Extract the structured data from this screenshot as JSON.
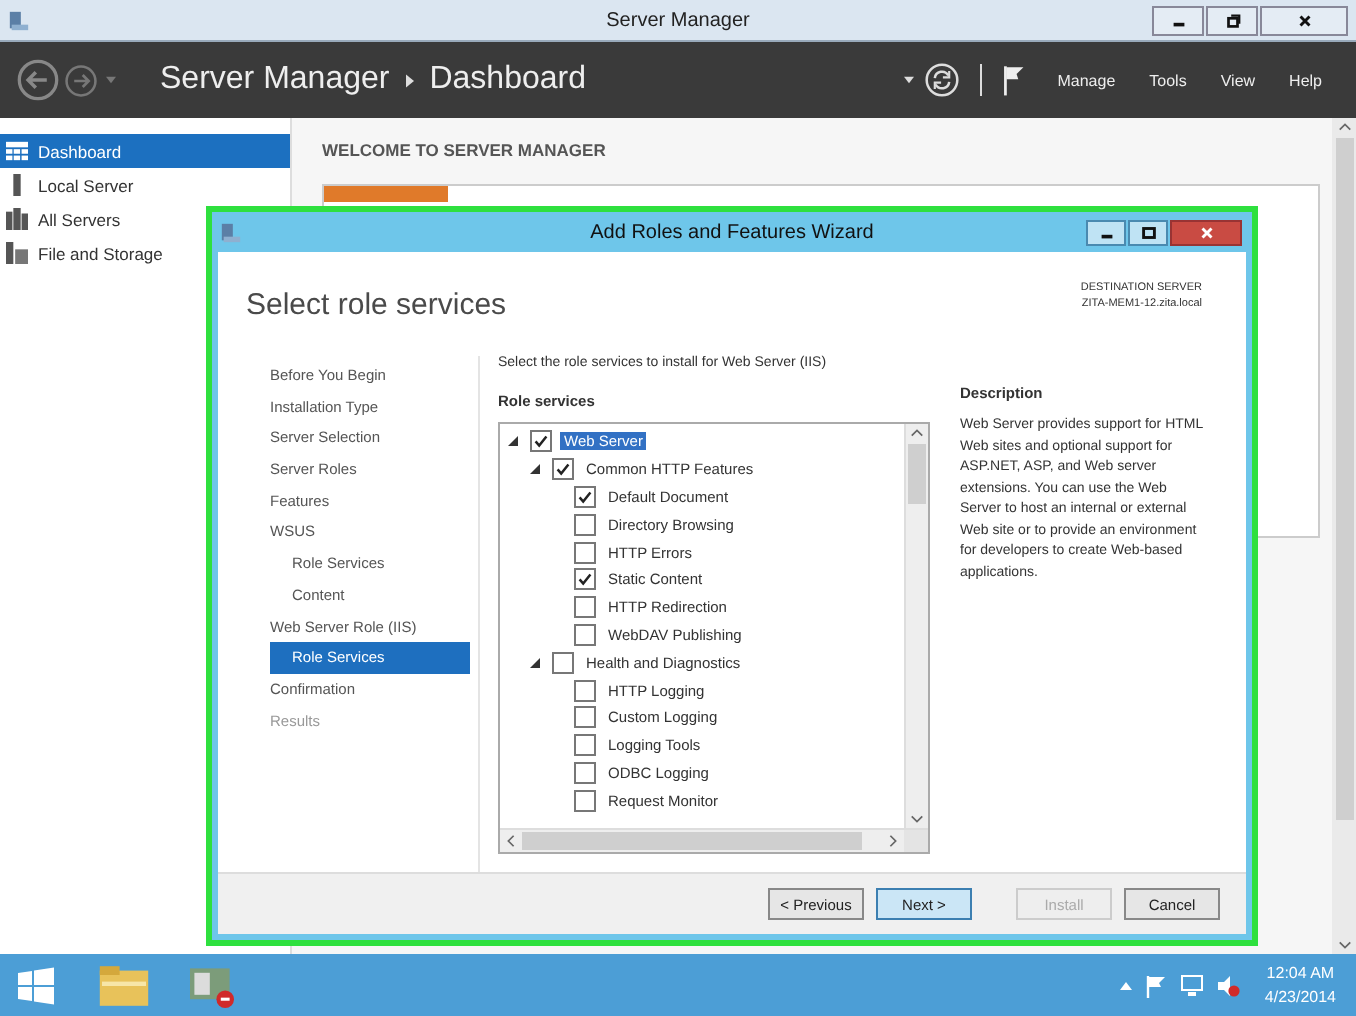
{
  "window": {
    "title": "Server Manager"
  },
  "header": {
    "breadcrumb": [
      "Server Manager",
      "Dashboard"
    ],
    "menus": [
      "Manage",
      "Tools",
      "View",
      "Help"
    ]
  },
  "sidebar": {
    "items": [
      {
        "label": "Dashboard",
        "selected": true
      },
      {
        "label": "Local Server",
        "selected": false
      },
      {
        "label": "All Servers",
        "selected": false
      },
      {
        "label": "File and Storage",
        "selected": false
      }
    ]
  },
  "main": {
    "heading": "WELCOME TO SERVER MANAGER"
  },
  "wizard": {
    "title": "Add Roles and Features Wizard",
    "heading": "Select role services",
    "destination_label": "DESTINATION SERVER",
    "destination_server": "ZITA-MEM1-12.zita.local",
    "nav": [
      {
        "label": "Before You Begin",
        "selected": false,
        "disabled": false
      },
      {
        "label": "Installation Type",
        "selected": false,
        "disabled": false
      },
      {
        "label": "Server Selection",
        "selected": false,
        "disabled": false
      },
      {
        "label": "Server Roles",
        "selected": false,
        "disabled": false
      },
      {
        "label": "Features",
        "selected": false,
        "disabled": false
      },
      {
        "label": "WSUS",
        "selected": false,
        "disabled": false,
        "children": [
          {
            "label": "Role Services",
            "selected": false,
            "disabled": false
          },
          {
            "label": "Content",
            "selected": false,
            "disabled": false
          }
        ]
      },
      {
        "label": "Web Server Role (IIS)",
        "selected": false,
        "disabled": false,
        "children": [
          {
            "label": "Role Services",
            "selected": true,
            "disabled": false
          }
        ]
      },
      {
        "label": "Confirmation",
        "selected": false,
        "disabled": false
      },
      {
        "label": "Results",
        "selected": false,
        "disabled": true
      }
    ],
    "instruction": "Select the role services to install for Web Server (IIS)",
    "list_label": "Role services",
    "tree": [
      {
        "label": "Web Server",
        "checked": true,
        "expanded": true,
        "selected": true,
        "children": [
          {
            "label": "Common HTTP Features",
            "checked": true,
            "expanded": true,
            "selected": false,
            "children": [
              {
                "label": "Default Document",
                "checked": true,
                "selected": false
              },
              {
                "label": "Directory Browsing",
                "checked": false,
                "selected": false
              },
              {
                "label": "HTTP Errors",
                "checked": false,
                "selected": false
              },
              {
                "label": "Static Content",
                "checked": true,
                "selected": false
              },
              {
                "label": "HTTP Redirection",
                "checked": false,
                "selected": false
              },
              {
                "label": "WebDAV Publishing",
                "checked": false,
                "selected": false
              }
            ]
          },
          {
            "label": "Health and Diagnostics",
            "checked": false,
            "expanded": true,
            "selected": false,
            "children": [
              {
                "label": "HTTP Logging",
                "checked": false,
                "selected": false
              },
              {
                "label": "Custom Logging",
                "checked": false,
                "selected": false
              },
              {
                "label": "Logging Tools",
                "checked": false,
                "selected": false
              },
              {
                "label": "ODBC Logging",
                "checked": false,
                "selected": false
              },
              {
                "label": "Request Monitor",
                "checked": false,
                "selected": false
              }
            ]
          }
        ]
      }
    ],
    "description_title": "Description",
    "description": "Web Server provides support for HTML Web sites and optional support for ASP.NET, ASP, and Web server extensions. You can use the Web Server to host an internal or external Web site or to provide an environment for developers to create Web-based applications.",
    "buttons": [
      {
        "label": "< Previous",
        "disabled": false,
        "hovered": false
      },
      {
        "label": "Next >",
        "disabled": false,
        "hovered": true
      },
      {
        "label": "Install",
        "disabled": true,
        "hovered": false
      },
      {
        "label": "Cancel",
        "disabled": false,
        "hovered": false
      }
    ]
  },
  "taskbar": {
    "time": "12:04 AM",
    "date": "4/23/2014"
  }
}
